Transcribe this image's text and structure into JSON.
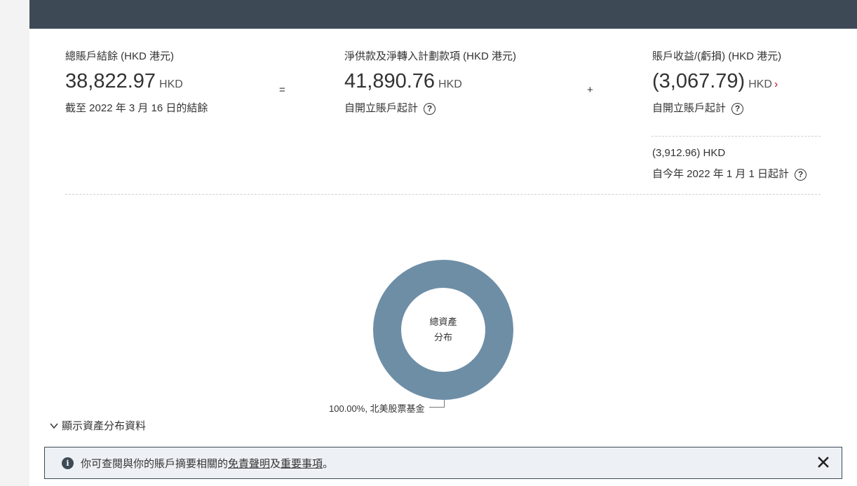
{
  "summary": {
    "balance": {
      "label": "總賬戶結餘 (HKD 港元)",
      "value": "38,822.97",
      "currency": "HKD",
      "note": "截至 2022 年 3 月 16 日的結餘"
    },
    "equals_sign": "=",
    "contributions": {
      "label": "淨供款及淨轉入計劃款項 (HKD 港元)",
      "value": "41,890.76",
      "currency": "HKD",
      "note": "自開立賬戶起計",
      "help": "?"
    },
    "plus_sign": "+",
    "gain_loss": {
      "label": "賬戶收益/(虧損) (HKD 港元)",
      "value": "(3,067.79)",
      "currency": "HKD",
      "chevron": "›",
      "note": "自開立賬戶起計",
      "help": "?",
      "ytd_value": "(3,912.96) HKD",
      "ytd_note": "自今年 2022 年 1 月 1 日起計",
      "ytd_help": "?",
      "chevron_color": "#c8102e"
    }
  },
  "allocation": {
    "center_line1": "總資產",
    "center_line2": "分布",
    "donut_color": "#6e8ea6",
    "slices": [
      {
        "label": "100.00%, 北美股票基金",
        "percent": 100
      }
    ],
    "toggle_label": "顯示資產分布資料"
  },
  "notice": {
    "text_before": "你可查閱與你的賬戶摘要相關的",
    "link1": "免責聲明",
    "middle": "及",
    "link2": "重要事項",
    "text_after": "。"
  },
  "colors": {
    "header_bar": "#3d4a56",
    "accent": "#c8102e"
  }
}
